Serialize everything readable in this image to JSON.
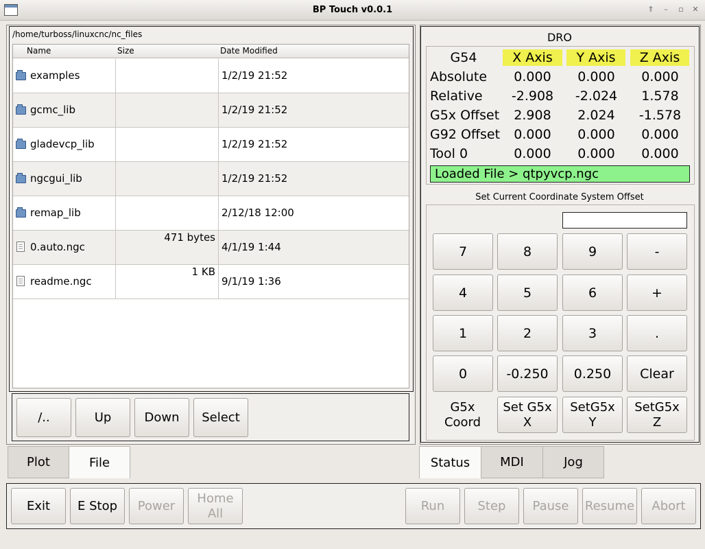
{
  "window": {
    "title": "BP Touch v0.0.1"
  },
  "file_browser": {
    "path": "/home/turboss/linuxcnc/nc_files",
    "columns": {
      "name": "Name",
      "size": "Size",
      "date": "Date Modified"
    },
    "rows": [
      {
        "name": "examples",
        "size": "",
        "date": "1/2/19 21:52",
        "icon": "folder-icon"
      },
      {
        "name": "gcmc_lib",
        "size": "",
        "date": "1/2/19 21:52",
        "icon": "folder-icon"
      },
      {
        "name": "gladevcp_lib",
        "size": "",
        "date": "1/2/19 21:52",
        "icon": "folder-icon"
      },
      {
        "name": "ngcgui_lib",
        "size": "",
        "date": "1/2/19 21:52",
        "icon": "folder-icon"
      },
      {
        "name": "remap_lib",
        "size": "",
        "date": "2/12/18 12:00",
        "icon": "folder-icon"
      },
      {
        "name": "0.auto.ngc",
        "size": "471 bytes",
        "date": "4/1/19 1:44",
        "icon": "file-icon"
      },
      {
        "name": "readme.ngc",
        "size": "1 KB",
        "date": "9/1/19 1:36",
        "icon": "file-icon"
      }
    ],
    "buttons": {
      "root": "/..",
      "up": "Up",
      "down": "Down",
      "select": "Select"
    }
  },
  "left_tabs": {
    "plot": "Plot",
    "file": "File",
    "active": "File"
  },
  "dro": {
    "title": "DRO",
    "coord_system": "G54",
    "axes": [
      "X Axis",
      "Y Axis",
      "Z Axis"
    ],
    "rows": [
      {
        "label": "Absolute",
        "values": [
          "0.000",
          "0.000",
          "0.000"
        ]
      },
      {
        "label": "Relative",
        "values": [
          "-2.908",
          "-2.024",
          "1.578"
        ]
      },
      {
        "label": "G5x Offset",
        "values": [
          "2.908",
          "2.024",
          "-1.578"
        ]
      },
      {
        "label": "G92 Offset",
        "values": [
          "0.000",
          "0.000",
          "0.000"
        ]
      },
      {
        "label": "Tool 0",
        "values": [
          "0.000",
          "0.000",
          "0.000"
        ]
      }
    ],
    "loaded_file": "Loaded File > qtpyvcp.ngc",
    "axis_header_color": "#f0f04e",
    "loaded_color": "#8ef28c"
  },
  "offset": {
    "title": "Set Current Coordinate System Offset",
    "input_value": "",
    "keys": [
      [
        "7",
        "8",
        "9",
        "-"
      ],
      [
        "4",
        "5",
        "6",
        "+"
      ],
      [
        "1",
        "2",
        "3",
        "."
      ],
      [
        "0",
        "-0.250",
        "0.250",
        "Clear"
      ]
    ],
    "g5x_label_1": "G5x",
    "g5x_label_2": "Coord",
    "set_x_1": "Set G5x",
    "set_x_2": "X",
    "set_y_1": "SetG5x",
    "set_y_2": "Y",
    "set_z_1": "SetG5x",
    "set_z_2": "Z"
  },
  "right_tabs": {
    "status": "Status",
    "mdi": "MDI",
    "jog": "Jog",
    "active": "Status"
  },
  "bottom_buttons": {
    "exit": "Exit",
    "estop": "E Stop",
    "power": "Power",
    "home_1": "Home",
    "home_2": "All",
    "run": "Run",
    "step": "Step",
    "pause": "Pause",
    "resume": "Resume",
    "abort": "Abort"
  }
}
